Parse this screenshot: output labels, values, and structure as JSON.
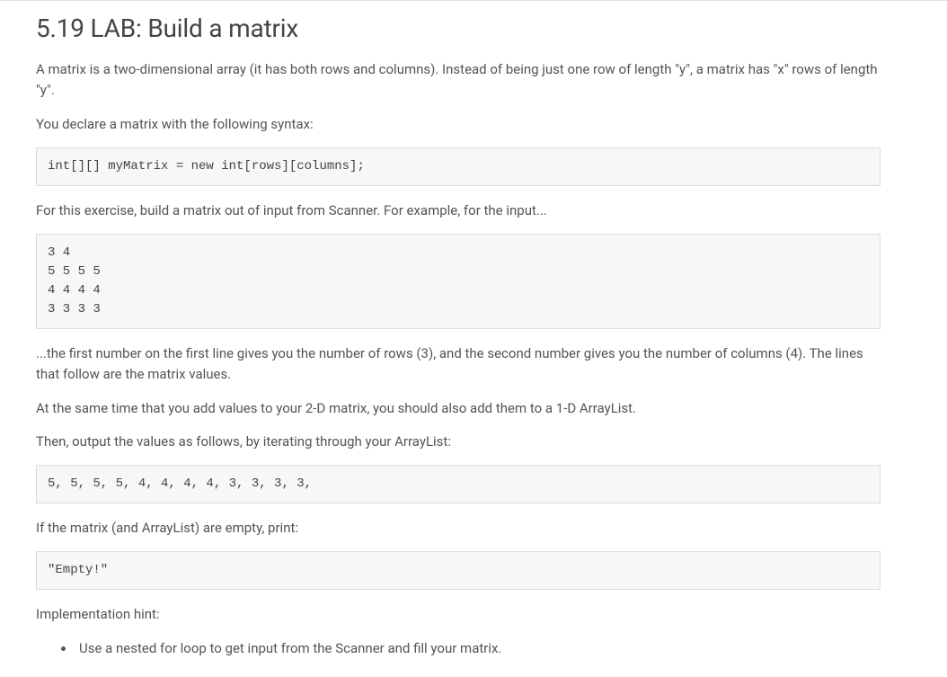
{
  "title": "5.19 LAB: Build a matrix",
  "para1": "A matrix is a two-dimensional array (it has both rows and columns). Instead of being just one row of length \"y\", a matrix has \"x\" rows of length \"y\".",
  "para2": "You declare a matrix with the following syntax:",
  "code1": "int[][] myMatrix = new int[rows][columns];",
  "para3": "For this exercise, build a matrix out of input from Scanner. For example, for the input...",
  "code2": "3 4\n5 5 5 5\n4 4 4 4\n3 3 3 3",
  "para4": "...the first number on the first line gives you the number of rows (3), and the second number gives you the number of columns (4). The lines that follow are the matrix values.",
  "para5": "At the same time that you add values to your 2-D matrix, you should also add them to a 1-D ArrayList.",
  "para6": "Then, output the values as follows, by iterating through your ArrayList:",
  "code3": "5, 5, 5, 5, 4, 4, 4, 4, 3, 3, 3, 3,",
  "para7": "If the matrix (and ArrayList) are empty, print:",
  "code4": "\"Empty!\"",
  "para8": "Implementation hint:",
  "hint1": "Use a nested for loop to get input from the Scanner and fill your matrix."
}
